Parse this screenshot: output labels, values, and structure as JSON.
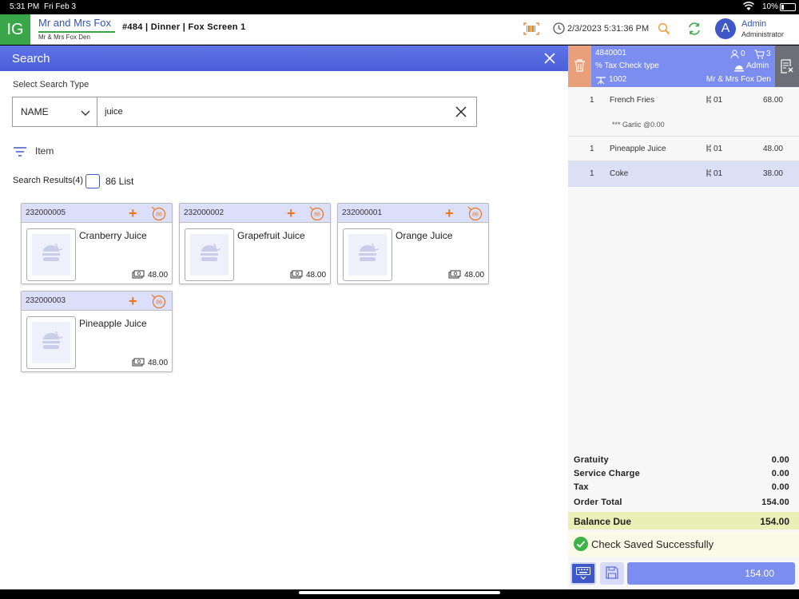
{
  "status_bar": {
    "time": "5:31 PM",
    "date": "Fri Feb 3",
    "battery": "10%"
  },
  "header": {
    "logo": "IG",
    "store_name": "Mr and Mrs Fox",
    "store_sub": "Mr & Mrs Fox Den",
    "order_info": "#484 | Dinner | Fox Screen 1",
    "datetime": "2/3/2023 5:31:36 PM",
    "user_initial": "A",
    "user_name": "Admin",
    "user_role": "Administrator"
  },
  "search": {
    "title": "Search",
    "type_label": "Select Search Type",
    "type_value": "NAME",
    "query": "juice",
    "filter_label": "Item",
    "results_label": "Search Results(4)",
    "list86_label": "86 List",
    "badge_86": "86",
    "results": [
      {
        "code": "232000005",
        "name": "Cranberry Juice",
        "price": "48.00"
      },
      {
        "code": "232000002",
        "name": "Grapefruit Juice",
        "price": "48.00"
      },
      {
        "code": "232000001",
        "name": "Orange Juice",
        "price": "48.00"
      },
      {
        "code": "232000003",
        "name": "Pineapple Juice",
        "price": "48.00"
      }
    ]
  },
  "check": {
    "number": "4840001",
    "tax_type": "% Tax Check type",
    "table": "1002",
    "guests": "0",
    "items_count": "3",
    "server": "Admin",
    "store": "Mr & Mrs Fox Den",
    "items": [
      {
        "qty": "1",
        "name": "French Fries",
        "seat": "01",
        "price": "68.00",
        "modifier": "*** Garlic @0.00"
      },
      {
        "qty": "1",
        "name": "Pineapple Juice",
        "seat": "01",
        "price": "48.00"
      },
      {
        "qty": "1",
        "name": "Coke",
        "seat": "01",
        "price": "38.00"
      }
    ],
    "gratuity_label": "Gratuity",
    "gratuity": "0.00",
    "service_label": "Service Charge",
    "service": "0.00",
    "tax_label": "Tax",
    "tax": "0.00",
    "order_total_label": "Order Total",
    "order_total": "154.00",
    "balance_label": "Balance Due",
    "balance": "154.00",
    "saved_message": "Check Saved Successfully",
    "pay_amount": "154.00"
  },
  "colors": {
    "accent": "#3e59c7",
    "header_blue": "#7c8df0",
    "brand_green": "#3aa64a",
    "orange": "#e87722"
  }
}
